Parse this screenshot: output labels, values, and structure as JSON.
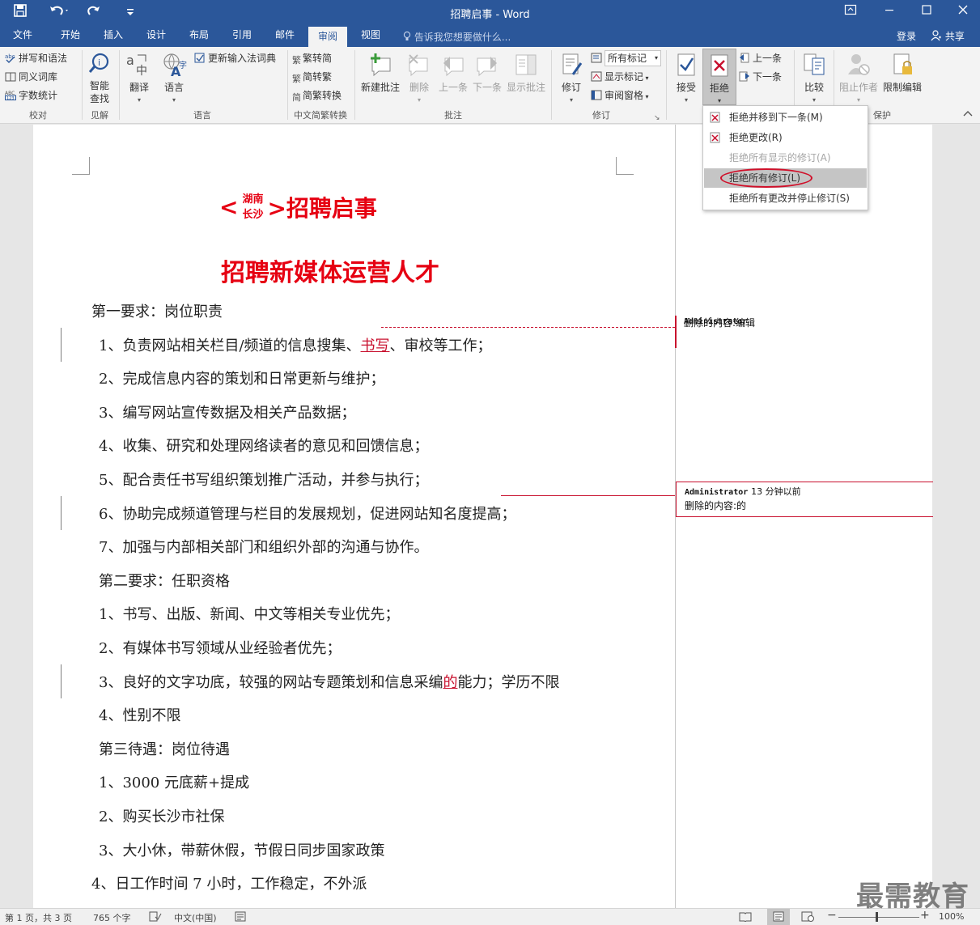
{
  "window": {
    "title": "招聘启事 - Word",
    "qa_save_icon": "save-icon",
    "qa_undo_icon": "undo-icon",
    "qa_redo_icon": "redo-icon",
    "qa_customize_icon": "customize-qat-icon"
  },
  "tabs": [
    {
      "label": "文件"
    },
    {
      "label": "开始"
    },
    {
      "label": "插入"
    },
    {
      "label": "设计"
    },
    {
      "label": "布局"
    },
    {
      "label": "引用"
    },
    {
      "label": "邮件"
    },
    {
      "label": "审阅",
      "active": true
    },
    {
      "label": "视图"
    }
  ],
  "tell_me": "告诉我您想要做什么...",
  "account": {
    "login": "登录",
    "share": "共享"
  },
  "ribbon": {
    "proofing": {
      "spelling": "拼写和语法",
      "thesaurus": "同义词库",
      "word_count": "字数统计",
      "group": "校对"
    },
    "insights": {
      "smart_lookup": "智能\n查找",
      "smart1": "智能",
      "smart2": "查找",
      "group": "见解"
    },
    "language": {
      "translate": "翻译",
      "language": "语言",
      "update_ime": "更新输入法词典",
      "group": "语言"
    },
    "chinese": {
      "t2s": "繁转简",
      "s2t": "简转繁",
      "convert": "简繁转换",
      "group": "中文简繁转换"
    },
    "comments": {
      "new": "新建批注",
      "delete": "删除",
      "prev": "上一条",
      "next": "下一条",
      "show": "显示批注",
      "group": "批注"
    },
    "tracking": {
      "track": "修订",
      "markup_select": "所有标记",
      "show_markup": "显示标记",
      "pane": "审阅窗格",
      "group": "修订"
    },
    "changes": {
      "accept": "接受",
      "reject": "拒绝",
      "prev": "上一条",
      "next": "下一条"
    },
    "compare": {
      "compare": "比较"
    },
    "protect": {
      "block": "阻止作者",
      "restrict": "限制编辑",
      "group": "保护"
    }
  },
  "reject_menu": [
    {
      "label": "拒绝并移到下一条(M)",
      "enabled": true
    },
    {
      "label": "拒绝更改(R)",
      "enabled": true
    },
    {
      "label": "拒绝所有显示的修订(A)",
      "enabled": false
    },
    {
      "label": "拒绝所有修订(L)",
      "enabled": true,
      "highlighted": true
    },
    {
      "label": "拒绝所有更改并停止修订(S)",
      "enabled": true
    }
  ],
  "document": {
    "title_badge_top": "湖南",
    "title_badge_bottom": "长沙",
    "title_left_bracket": "<",
    "title_right": ">招聘启事",
    "subtitle": "招聘新媒体运营人才",
    "lines": [
      {
        "text": "第一要求：岗位职责"
      },
      {
        "pre": "1、负责网站相关栏目/频道的信息搜集、",
        "ins": "书写",
        "post": "、审校等工作；"
      },
      {
        "text": "2、完成信息内容的策划和日常更新与维护；"
      },
      {
        "text": "3、编写网站宣传数据及相关产品数据；"
      },
      {
        "text": "4、收集、研究和处理网络读者的意见和回馈信息；"
      },
      {
        "text": "5、配合责任书写组织策划推广活动，并参与执行；"
      },
      {
        "text": "6、协助完成频道管理与栏目的发展规划，促进网站知名度提高；"
      },
      {
        "text": "7、加强与内部相关部门和组织外部的沟通与协作。"
      },
      {
        "text": "第二要求：任职资格"
      },
      {
        "text": "1、书写、出版、新闻、中文等相关专业优先；"
      },
      {
        "text": "2、有媒体书写领域从业经验者优先；"
      },
      {
        "pre": "3、良好的文字功底，较强的网站专题策划和信息采编",
        "ins": "的",
        "post": "能力；学历不限"
      },
      {
        "text": "4、性别不限"
      },
      {
        "text": "第三待遇：岗位待遇"
      },
      {
        "text": "1、3000 元底薪+提成"
      },
      {
        "text": "2、购买长沙市社保"
      },
      {
        "text": "3、大小休，带薪休假，节假日同步国家政策"
      },
      {
        "text": "4、日工作时间 7 小时，工作稳定，不外派"
      }
    ]
  },
  "balloons": [
    {
      "author": "Administrator",
      "time": "",
      "text": "删除的内容:编辑"
    },
    {
      "author": "Administrator",
      "time": "13 分钟以前",
      "text": "删除的内容:的"
    }
  ],
  "status": {
    "page": "第 1 页，共 3 页",
    "words": "765 个字",
    "lang": "中文(中国)",
    "zoom": "100%"
  },
  "watermark": "最需教育",
  "colors": {
    "ribbon_blue": "#2b579a",
    "revision_red": "#c8102e",
    "title_red": "#e60012"
  }
}
